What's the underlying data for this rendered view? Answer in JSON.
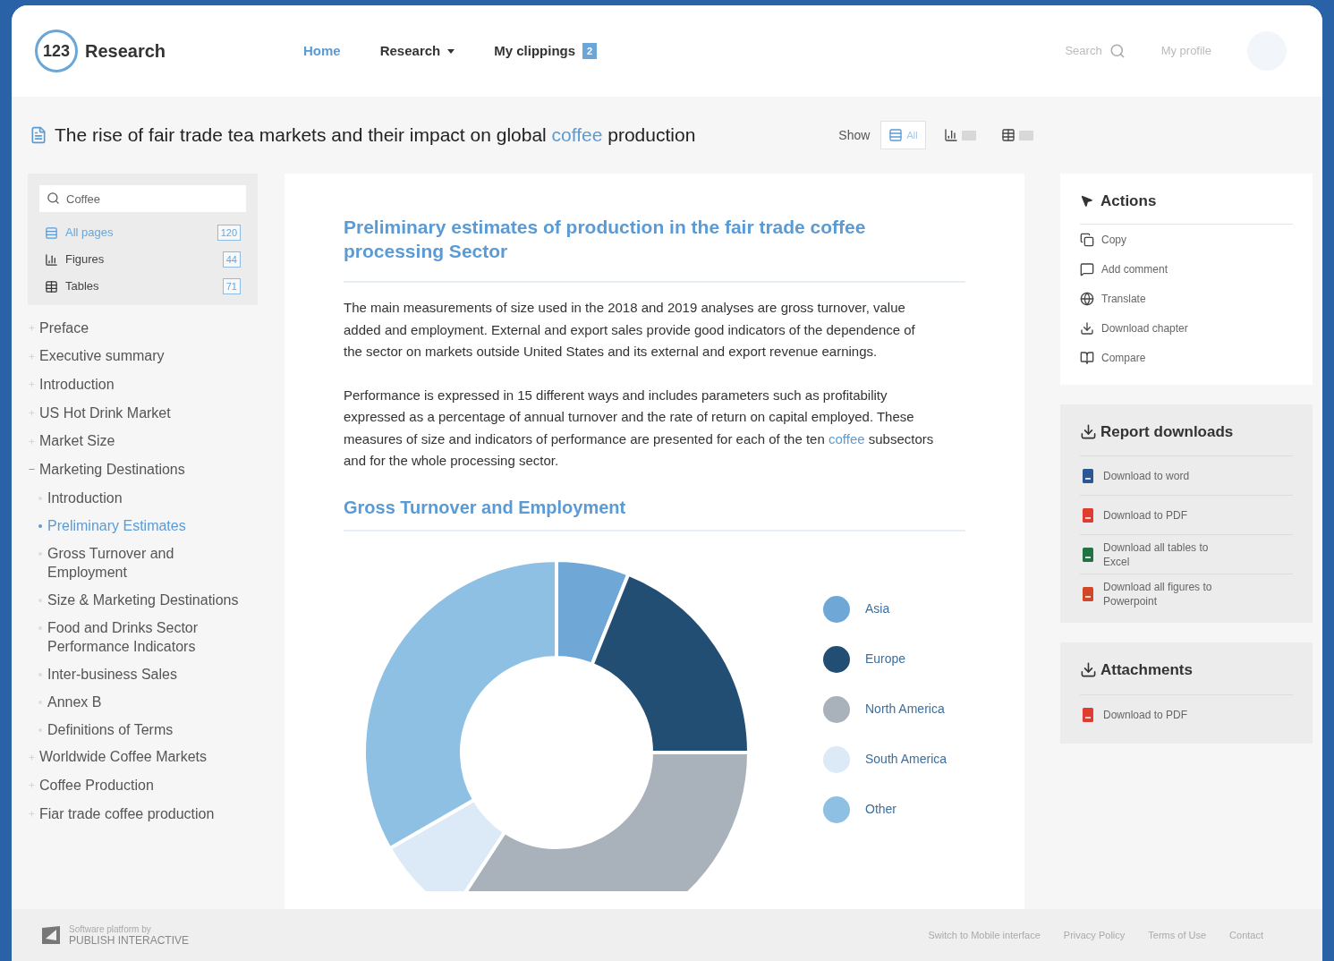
{
  "header": {
    "logo_mark": "123",
    "logo_text": "Research",
    "nav": [
      {
        "label": "Home",
        "selected": true,
        "dropdown": false
      },
      {
        "label": "Research",
        "selected": false,
        "dropdown": true
      },
      {
        "label": "My clippings",
        "selected": false,
        "dropdown": false,
        "badge": "2"
      }
    ],
    "search_label": "Search",
    "profile_label": "My profile"
  },
  "title": [
    {
      "text": "The rise of fair trade tea markets and their impact on global ",
      "highlight": false
    },
    {
      "text": "coffee",
      "highlight": true
    },
    {
      "text": " production",
      "highlight": false
    }
  ],
  "show": {
    "label": "Show",
    "views": [
      {
        "kind": "all",
        "label": "All",
        "selected": true
      },
      {
        "kind": "figures",
        "selected": false
      },
      {
        "kind": "tables",
        "selected": false
      }
    ]
  },
  "sidebar": {
    "search": {
      "value": "Coffee"
    },
    "filters": [
      {
        "label": "All pages",
        "count": "120",
        "selected": true
      },
      {
        "label": "Figures",
        "count": "44",
        "selected": false
      },
      {
        "label": "Tables",
        "count": "71",
        "selected": false
      }
    ],
    "toc": [
      {
        "label": "Preface",
        "expanded": false
      },
      {
        "label": "Executive summary",
        "expanded": false
      },
      {
        "label": "Introduction",
        "expanded": false
      },
      {
        "label": "US Hot Drink Market",
        "expanded": false
      },
      {
        "label": "Market Size",
        "expanded": false
      },
      {
        "label": "Marketing Destinations",
        "expanded": true,
        "children": [
          {
            "label": "Introduction",
            "selected": false
          },
          {
            "label": "Preliminary Estimates",
            "selected": true
          },
          {
            "label": "Gross Turnover and Employment",
            "selected": false
          },
          {
            "label": "Size & Marketing Destinations",
            "selected": false
          },
          {
            "label": "Food and Drinks Sector Performance Indicators",
            "selected": false
          },
          {
            "label": "Inter-business Sales",
            "selected": false
          },
          {
            "label": "Annex B",
            "selected": false
          },
          {
            "label": "Definitions of Terms",
            "selected": false
          }
        ]
      },
      {
        "label": "Worldwide Coffee Markets",
        "expanded": false
      },
      {
        "label": "Coffee Production",
        "expanded": false
      },
      {
        "label": "Fiar trade coffee production",
        "expanded": false
      }
    ]
  },
  "article": {
    "heading": "Preliminary estimates of production in the fair trade coffee processing Sector",
    "paragraphs": [
      [
        {
          "text": "The main measurements of size used in the 2018 and 2019 analyses are gross turnover, value added and employment. External and export sales provide good indicators of the dependence of the sector on markets outside United States and its external and export revenue earnings.",
          "highlight": false
        }
      ],
      [
        {
          "text": "Performance is expressed in 15 different ways and includes parameters such as profitability expressed as a percentage of annual turnover and the rate of return on capital employed. These measures of size and indicators of performance are presented for each of the ten ",
          "highlight": false
        },
        {
          "text": "coffee",
          "highlight": true
        },
        {
          "text": " subsectors and for the whole processing sector.",
          "highlight": false
        }
      ]
    ],
    "subheading": "Gross Turnover and Employment",
    "legend": [
      {
        "label": "Asia",
        "color": "#6fa8d6"
      },
      {
        "label": "Europe",
        "color": "#234e73"
      },
      {
        "label": "North America",
        "color": "#a9b1bb"
      },
      {
        "label": "South America",
        "color": "#dce9f6"
      },
      {
        "label": "Other",
        "color": "#8ec0e4"
      }
    ]
  },
  "actions": {
    "title": "Actions",
    "items": [
      "Copy",
      "Add comment",
      "Translate",
      "Download chapter",
      "Compare"
    ]
  },
  "report_downloads": {
    "title": "Report downloads",
    "items": [
      "Download to word",
      "Download to PDF",
      "Download all tables to Excel",
      "Download all figures to Powerpoint"
    ]
  },
  "attachments": {
    "title": "Attachments",
    "items": [
      "Download to PDF"
    ]
  },
  "footer": {
    "brand_small": "Software platform by",
    "brand": "PUBLISH INTERACTIVE",
    "links": [
      "Switch to Mobile interface",
      "Privacy Policy",
      "Terms of Use",
      "Contact"
    ]
  }
}
